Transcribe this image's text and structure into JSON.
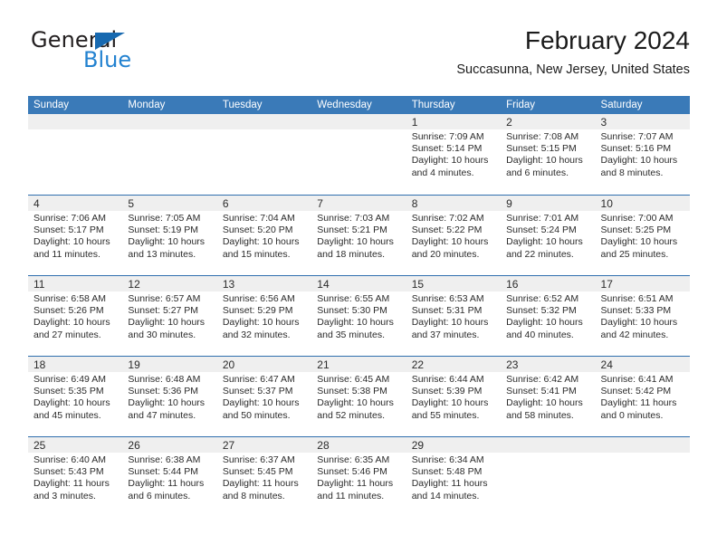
{
  "brand": {
    "line1": "General",
    "line2": "Blue",
    "triangle_color": "#1769b0",
    "line2_color": "#2382d0"
  },
  "header": {
    "title": "February 2024",
    "subtitle": "Succasunna, New Jersey, United States"
  },
  "colors": {
    "header_blue": "#3a7ab8",
    "row_divider": "#2f6fae",
    "date_band": "#efefef"
  },
  "calendar": {
    "weekday_headers": [
      "Sunday",
      "Monday",
      "Tuesday",
      "Wednesday",
      "Thursday",
      "Friday",
      "Saturday"
    ],
    "weeks": [
      [
        {
          "day": "",
          "sunrise": "",
          "sunset": "",
          "daylight1": "",
          "daylight2": ""
        },
        {
          "day": "",
          "sunrise": "",
          "sunset": "",
          "daylight1": "",
          "daylight2": ""
        },
        {
          "day": "",
          "sunrise": "",
          "sunset": "",
          "daylight1": "",
          "daylight2": ""
        },
        {
          "day": "",
          "sunrise": "",
          "sunset": "",
          "daylight1": "",
          "daylight2": ""
        },
        {
          "day": "1",
          "sunrise": "Sunrise: 7:09 AM",
          "sunset": "Sunset: 5:14 PM",
          "daylight1": "Daylight: 10 hours",
          "daylight2": "and 4 minutes."
        },
        {
          "day": "2",
          "sunrise": "Sunrise: 7:08 AM",
          "sunset": "Sunset: 5:15 PM",
          "daylight1": "Daylight: 10 hours",
          "daylight2": "and 6 minutes."
        },
        {
          "day": "3",
          "sunrise": "Sunrise: 7:07 AM",
          "sunset": "Sunset: 5:16 PM",
          "daylight1": "Daylight: 10 hours",
          "daylight2": "and 8 minutes."
        }
      ],
      [
        {
          "day": "4",
          "sunrise": "Sunrise: 7:06 AM",
          "sunset": "Sunset: 5:17 PM",
          "daylight1": "Daylight: 10 hours",
          "daylight2": "and 11 minutes."
        },
        {
          "day": "5",
          "sunrise": "Sunrise: 7:05 AM",
          "sunset": "Sunset: 5:19 PM",
          "daylight1": "Daylight: 10 hours",
          "daylight2": "and 13 minutes."
        },
        {
          "day": "6",
          "sunrise": "Sunrise: 7:04 AM",
          "sunset": "Sunset: 5:20 PM",
          "daylight1": "Daylight: 10 hours",
          "daylight2": "and 15 minutes."
        },
        {
          "day": "7",
          "sunrise": "Sunrise: 7:03 AM",
          "sunset": "Sunset: 5:21 PM",
          "daylight1": "Daylight: 10 hours",
          "daylight2": "and 18 minutes."
        },
        {
          "day": "8",
          "sunrise": "Sunrise: 7:02 AM",
          "sunset": "Sunset: 5:22 PM",
          "daylight1": "Daylight: 10 hours",
          "daylight2": "and 20 minutes."
        },
        {
          "day": "9",
          "sunrise": "Sunrise: 7:01 AM",
          "sunset": "Sunset: 5:24 PM",
          "daylight1": "Daylight: 10 hours",
          "daylight2": "and 22 minutes."
        },
        {
          "day": "10",
          "sunrise": "Sunrise: 7:00 AM",
          "sunset": "Sunset: 5:25 PM",
          "daylight1": "Daylight: 10 hours",
          "daylight2": "and 25 minutes."
        }
      ],
      [
        {
          "day": "11",
          "sunrise": "Sunrise: 6:58 AM",
          "sunset": "Sunset: 5:26 PM",
          "daylight1": "Daylight: 10 hours",
          "daylight2": "and 27 minutes."
        },
        {
          "day": "12",
          "sunrise": "Sunrise: 6:57 AM",
          "sunset": "Sunset: 5:27 PM",
          "daylight1": "Daylight: 10 hours",
          "daylight2": "and 30 minutes."
        },
        {
          "day": "13",
          "sunrise": "Sunrise: 6:56 AM",
          "sunset": "Sunset: 5:29 PM",
          "daylight1": "Daylight: 10 hours",
          "daylight2": "and 32 minutes."
        },
        {
          "day": "14",
          "sunrise": "Sunrise: 6:55 AM",
          "sunset": "Sunset: 5:30 PM",
          "daylight1": "Daylight: 10 hours",
          "daylight2": "and 35 minutes."
        },
        {
          "day": "15",
          "sunrise": "Sunrise: 6:53 AM",
          "sunset": "Sunset: 5:31 PM",
          "daylight1": "Daylight: 10 hours",
          "daylight2": "and 37 minutes."
        },
        {
          "day": "16",
          "sunrise": "Sunrise: 6:52 AM",
          "sunset": "Sunset: 5:32 PM",
          "daylight1": "Daylight: 10 hours",
          "daylight2": "and 40 minutes."
        },
        {
          "day": "17",
          "sunrise": "Sunrise: 6:51 AM",
          "sunset": "Sunset: 5:33 PM",
          "daylight1": "Daylight: 10 hours",
          "daylight2": "and 42 minutes."
        }
      ],
      [
        {
          "day": "18",
          "sunrise": "Sunrise: 6:49 AM",
          "sunset": "Sunset: 5:35 PM",
          "daylight1": "Daylight: 10 hours",
          "daylight2": "and 45 minutes."
        },
        {
          "day": "19",
          "sunrise": "Sunrise: 6:48 AM",
          "sunset": "Sunset: 5:36 PM",
          "daylight1": "Daylight: 10 hours",
          "daylight2": "and 47 minutes."
        },
        {
          "day": "20",
          "sunrise": "Sunrise: 6:47 AM",
          "sunset": "Sunset: 5:37 PM",
          "daylight1": "Daylight: 10 hours",
          "daylight2": "and 50 minutes."
        },
        {
          "day": "21",
          "sunrise": "Sunrise: 6:45 AM",
          "sunset": "Sunset: 5:38 PM",
          "daylight1": "Daylight: 10 hours",
          "daylight2": "and 52 minutes."
        },
        {
          "day": "22",
          "sunrise": "Sunrise: 6:44 AM",
          "sunset": "Sunset: 5:39 PM",
          "daylight1": "Daylight: 10 hours",
          "daylight2": "and 55 minutes."
        },
        {
          "day": "23",
          "sunrise": "Sunrise: 6:42 AM",
          "sunset": "Sunset: 5:41 PM",
          "daylight1": "Daylight: 10 hours",
          "daylight2": "and 58 minutes."
        },
        {
          "day": "24",
          "sunrise": "Sunrise: 6:41 AM",
          "sunset": "Sunset: 5:42 PM",
          "daylight1": "Daylight: 11 hours",
          "daylight2": "and 0 minutes."
        }
      ],
      [
        {
          "day": "25",
          "sunrise": "Sunrise: 6:40 AM",
          "sunset": "Sunset: 5:43 PM",
          "daylight1": "Daylight: 11 hours",
          "daylight2": "and 3 minutes."
        },
        {
          "day": "26",
          "sunrise": "Sunrise: 6:38 AM",
          "sunset": "Sunset: 5:44 PM",
          "daylight1": "Daylight: 11 hours",
          "daylight2": "and 6 minutes."
        },
        {
          "day": "27",
          "sunrise": "Sunrise: 6:37 AM",
          "sunset": "Sunset: 5:45 PM",
          "daylight1": "Daylight: 11 hours",
          "daylight2": "and 8 minutes."
        },
        {
          "day": "28",
          "sunrise": "Sunrise: 6:35 AM",
          "sunset": "Sunset: 5:46 PM",
          "daylight1": "Daylight: 11 hours",
          "daylight2": "and 11 minutes."
        },
        {
          "day": "29",
          "sunrise": "Sunrise: 6:34 AM",
          "sunset": "Sunset: 5:48 PM",
          "daylight1": "Daylight: 11 hours",
          "daylight2": "and 14 minutes."
        },
        {
          "day": "",
          "sunrise": "",
          "sunset": "",
          "daylight1": "",
          "daylight2": ""
        },
        {
          "day": "",
          "sunrise": "",
          "sunset": "",
          "daylight1": "",
          "daylight2": ""
        }
      ]
    ]
  }
}
